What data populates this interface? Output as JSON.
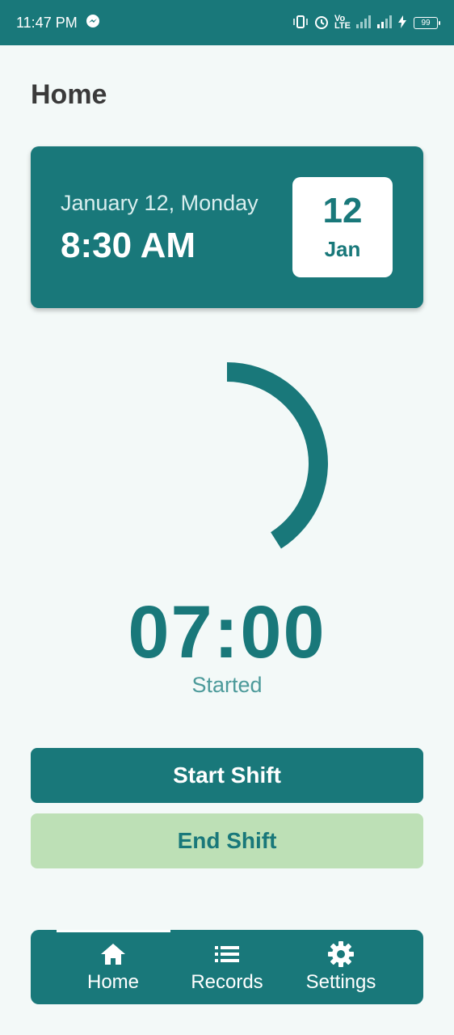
{
  "status_bar": {
    "time": "11:47 PM",
    "network_label": "Vo LTE",
    "battery_level": "99"
  },
  "page": {
    "title": "Home"
  },
  "date_card": {
    "date_text": "January 12, Monday",
    "time_text": "8:30 AM",
    "day_number": "12",
    "month_short": "Jan"
  },
  "timer": {
    "value": "07:00",
    "status": "Started",
    "progress_fraction": 0.41
  },
  "actions": {
    "start_label": "Start Shift",
    "end_label": "End Shift"
  },
  "bottom_nav": {
    "items": [
      {
        "label": "Home",
        "icon": "home-icon",
        "active": true
      },
      {
        "label": "Records",
        "icon": "list-icon",
        "active": false
      },
      {
        "label": "Settings",
        "icon": "gear-icon",
        "active": false
      }
    ]
  },
  "colors": {
    "primary": "#19787a",
    "secondary": "#bde0b6",
    "background": "#f3f9f8"
  }
}
